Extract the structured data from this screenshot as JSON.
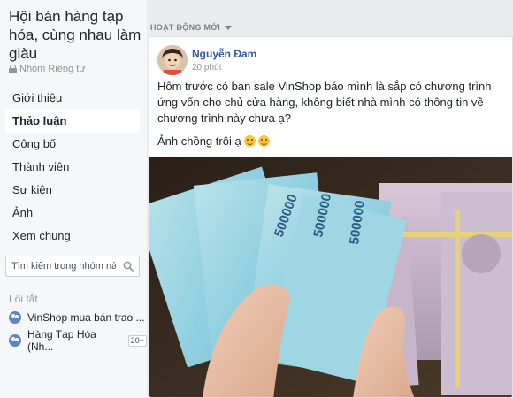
{
  "sidebar": {
    "group_title": "Hội bán hàng tạp hóa, cùng nhau làm giàu",
    "privacy": "Nhóm Riêng tư",
    "items": [
      {
        "label": "Giới thiệu"
      },
      {
        "label": "Thảo luận"
      },
      {
        "label": "Công bố"
      },
      {
        "label": "Thành viên"
      },
      {
        "label": "Sự kiện"
      },
      {
        "label": "Ảnh"
      },
      {
        "label": "Xem chung"
      }
    ],
    "search_placeholder": "Tìm kiếm trong nhóm này",
    "shortcuts_title": "Lối tắt",
    "shortcuts": [
      {
        "label": "VinShop mua bán trao ...",
        "badge": ""
      },
      {
        "label": "Hàng Tạp Hóa (Nh...",
        "badge": "20+"
      }
    ]
  },
  "feed": {
    "header": "HOẠT ĐỘNG MỚI"
  },
  "post": {
    "author": "Nguyễn Đam",
    "time": "20 phút",
    "text": "Hôm trước có bạn sale VinShop báo mình là sắp có chương trình ứng vốn cho chủ cửa hàng, không biết nhà mình có thông tin về chương trình này chưa ạ?",
    "text2": "Ảnh chồng trôi ạ",
    "photo_notes": [
      "500000",
      "500000",
      "500000"
    ]
  },
  "colors": {
    "link": "#365899",
    "sidebar_bg": "#f6f7f9",
    "page_bg": "#e9ebee"
  }
}
